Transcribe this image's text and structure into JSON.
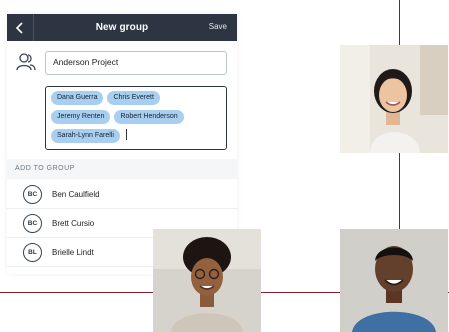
{
  "header": {
    "title": "New group",
    "save_label": "Save",
    "back_icon": "chevron-left-icon"
  },
  "group": {
    "name": "Anderson Project",
    "members": [
      "Dana Guerra",
      "Chris Everett",
      "Jeremy Renten",
      "Robert Henderson",
      "Sarah-Lynn Farelli"
    ]
  },
  "add_section": {
    "title": "ADD TO GROUP",
    "contacts": [
      {
        "initials": "BC",
        "name": "Ben Caulfield"
      },
      {
        "initials": "BC",
        "name": "Brett Cursio"
      },
      {
        "initials": "BL",
        "name": "Brielle Lindt"
      }
    ]
  },
  "colors": {
    "topbar": "#2c3541",
    "chip": "#a9cff0",
    "accent_line": "#8c1d28"
  }
}
